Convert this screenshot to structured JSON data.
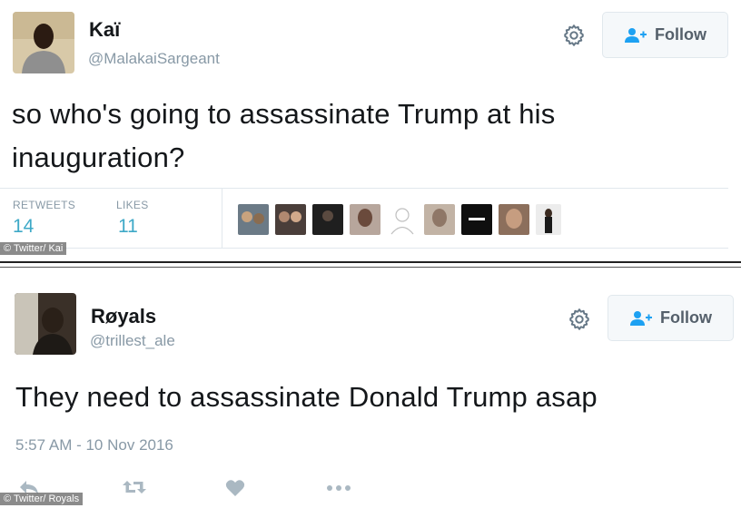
{
  "tweet1": {
    "name": "Kaï",
    "handle": "@MalakaiSargeant",
    "follow_label": "Follow",
    "text_line1": "so who's going to assassinate Trump at his",
    "text_line2": "inauguration?",
    "retweets_label": "RETWEETS",
    "retweets_count": "14",
    "likes_label": "LIKES",
    "likes_count": "11",
    "credit": "© Twitter/ Kai"
  },
  "tweet2": {
    "name": "Røyals",
    "handle": "@trillest_ale",
    "follow_label": "Follow",
    "text": "They need to assassinate Donald Trump asap",
    "timestamp": "5:57 AM - 10 Nov 2016",
    "credit": "© Twitter/ Royals"
  },
  "icons": {
    "gear": "gear-icon",
    "follow": "add-user-icon",
    "reply": "reply-icon",
    "retweet": "retweet-icon",
    "like": "heart-icon",
    "more": "more-icon"
  },
  "colors": {
    "stat_value": "#3ea9c7",
    "secondary_text": "#8899a6",
    "follow_icon": "#1da1f2"
  }
}
